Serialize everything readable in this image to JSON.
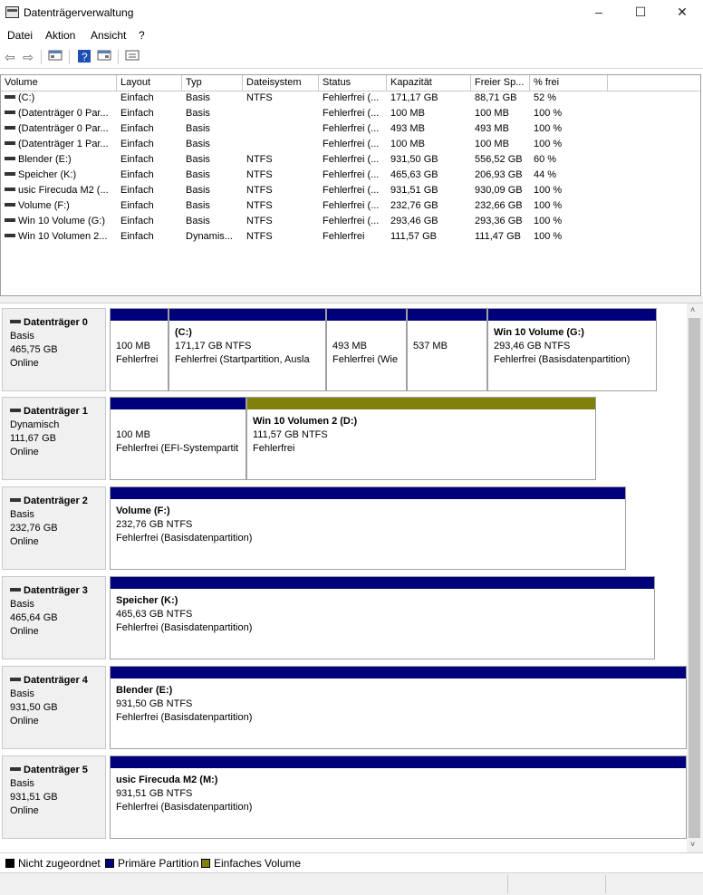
{
  "window": {
    "title": "Datenträgerverwaltung",
    "min": "–",
    "max": "☐",
    "close": "✕"
  },
  "menu": [
    "Datei",
    "Aktion",
    "Ansicht",
    "?"
  ],
  "columns": [
    "Volume",
    "Layout",
    "Typ",
    "Dateisystem",
    "Status",
    "Kapazität",
    "Freier Sp...",
    "% frei"
  ],
  "rows": [
    [
      "(C:)",
      "Einfach",
      "Basis",
      "NTFS",
      "Fehlerfrei (...",
      "171,17 GB",
      "88,71 GB",
      "52 %"
    ],
    [
      "(Datenträger 0 Par...",
      "Einfach",
      "Basis",
      "",
      "Fehlerfrei (...",
      "100 MB",
      "100 MB",
      "100 %"
    ],
    [
      "(Datenträger 0 Par...",
      "Einfach",
      "Basis",
      "",
      "Fehlerfrei (...",
      "493 MB",
      "493 MB",
      "100 %"
    ],
    [
      "(Datenträger 1 Par...",
      "Einfach",
      "Basis",
      "",
      "Fehlerfrei (...",
      "100 MB",
      "100 MB",
      "100 %"
    ],
    [
      "Blender (E:)",
      "Einfach",
      "Basis",
      "NTFS",
      "Fehlerfrei (...",
      "931,50 GB",
      "556,52 GB",
      "60 %"
    ],
    [
      "Speicher (K:)",
      "Einfach",
      "Basis",
      "NTFS",
      "Fehlerfrei (...",
      "465,63 GB",
      "206,93 GB",
      "44 %"
    ],
    [
      "usic Firecuda M2 (...",
      "Einfach",
      "Basis",
      "NTFS",
      "Fehlerfrei (...",
      "931,51 GB",
      "930,09 GB",
      "100 %"
    ],
    [
      "Volume (F:)",
      "Einfach",
      "Basis",
      "NTFS",
      "Fehlerfrei (...",
      "232,76 GB",
      "232,66 GB",
      "100 %"
    ],
    [
      "Win 10 Volume (G:)",
      "Einfach",
      "Basis",
      "NTFS",
      "Fehlerfrei (...",
      "293,46 GB",
      "293,36 GB",
      "100 %"
    ],
    [
      "Win 10 Volumen 2...",
      "Einfach",
      "Dynamis...",
      "NTFS",
      "Fehlerfrei",
      "111,57 GB",
      "111,47 GB",
      "100 %"
    ]
  ],
  "disks": [
    {
      "name": "Datenträger 0",
      "type": "Basis",
      "size": "465,75 GB",
      "state": "Online",
      "parts": [
        {
          "title": "",
          "l1": "100 MB",
          "l2": "Fehlerfrei",
          "color": "blue"
        },
        {
          "title": "(C:)",
          "l1": "171,17 GB NTFS",
          "l2": "Fehlerfrei (Startpartition, Ausla",
          "color": "blue"
        },
        {
          "title": "",
          "l1": "493 MB",
          "l2": "Fehlerfrei (Wie",
          "color": "blue"
        },
        {
          "title": "",
          "l1": "537 MB",
          "l2": "",
          "color": "blue"
        },
        {
          "title": "Win 10 Volume  (G:)",
          "l1": "293,46 GB NTFS",
          "l2": "Fehlerfrei (Basisdatenpartition)",
          "color": "blue"
        }
      ]
    },
    {
      "name": "Datenträger 1",
      "type": "Dynamisch",
      "size": "111,67 GB",
      "state": "Online",
      "parts": [
        {
          "title": "",
          "l1": "100 MB",
          "l2": "Fehlerfrei (EFI-Systempartit",
          "color": "blue"
        },
        {
          "title": "Win 10 Volumen 2  (D:)",
          "l1": "111,57 GB NTFS",
          "l2": "Fehlerfrei",
          "color": "olive"
        }
      ]
    },
    {
      "name": "Datenträger 2",
      "type": "Basis",
      "size": "232,76 GB",
      "state": "Online",
      "parts": [
        {
          "title": "Volume  (F:)",
          "l1": "232,76 GB NTFS",
          "l2": "Fehlerfrei (Basisdatenpartition)",
          "color": "blue"
        }
      ]
    },
    {
      "name": "Datenträger 3",
      "type": "Basis",
      "size": "465,64 GB",
      "state": "Online",
      "parts": [
        {
          "title": "Speicher  (K:)",
          "l1": "465,63 GB NTFS",
          "l2": "Fehlerfrei (Basisdatenpartition)",
          "color": "blue"
        }
      ]
    },
    {
      "name": "Datenträger 4",
      "type": "Basis",
      "size": "931,50 GB",
      "state": "Online",
      "parts": [
        {
          "title": "Blender  (E:)",
          "l1": "931,50 GB NTFS",
          "l2": "Fehlerfrei (Basisdatenpartition)",
          "color": "blue"
        }
      ]
    },
    {
      "name": "Datenträger 5",
      "type": "Basis",
      "size": "931,51 GB",
      "state": "Online",
      "parts": [
        {
          "title": "usic Firecuda M2  (M:)",
          "l1": "931,51 GB NTFS",
          "l2": "Fehlerfrei (Basisdatenpartition)",
          "color": "blue"
        }
      ]
    }
  ],
  "legend": [
    {
      "label": "Nicht zugeordnet",
      "color": "#000000"
    },
    {
      "label": "Primäre Partition",
      "color": "#00007a"
    },
    {
      "label": "Einfaches Volume",
      "color": "#80800a"
    }
  ],
  "icons": {
    "app": "disk-management-icon",
    "back": "back-arrow-icon",
    "forward": "forward-arrow-icon"
  }
}
